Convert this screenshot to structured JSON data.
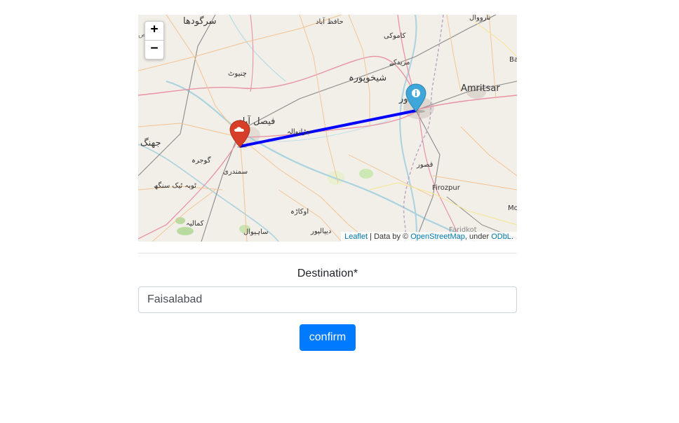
{
  "map": {
    "zoom_in": "+",
    "zoom_out": "−",
    "attribution": {
      "leaflet": "Leaflet",
      "separator": " | Data by © ",
      "osm": "OpenStreetMap",
      "under": ", under ",
      "odbl": "ODbL",
      "end": "."
    },
    "labels": {
      "sargodha": "سرگودھا",
      "hafizabad": "حافظ آباد",
      "narowal": "نارووال",
      "kamoke": "کاموکی",
      "chiniot": "چنیوٹ",
      "muridke": "مریدکے",
      "sheikhupura": "شیخوپورہ",
      "amritsar": "Amritsar",
      "lahore_partial": "ور",
      "faisalabad": "فیصل آباد",
      "jaranwala": "جڑانوالہ",
      "jhang": "جھنگ",
      "gojra": "گوجرہ",
      "samundri": "سمندری",
      "kasur": "قصور",
      "toba": "ٹوبہ ٹیک سنگھ",
      "firozpur": "Firozpur",
      "okara": "اوکاڑہ",
      "depalpur": "دیپالپور",
      "kamalia": "کمالیہ",
      "sahiwal": "ساہیوال",
      "ba_partial": "Ba",
      "mo_partial": "Mo",
      "faridkot_partial": "Faridkot",
      "nath_partial": "نحص"
    },
    "route_color": "#0000ff",
    "origin_marker_color": "#3ea6d8",
    "origin_marker_icon": "info-icon",
    "destination_marker_color": "#d63e2a",
    "destination_marker_icon": "cloud-icon"
  },
  "form": {
    "destination_label": "Destination*",
    "destination_value": "Faisalabad",
    "confirm_label": "confirm"
  },
  "colors": {
    "primary": "#007bff"
  }
}
